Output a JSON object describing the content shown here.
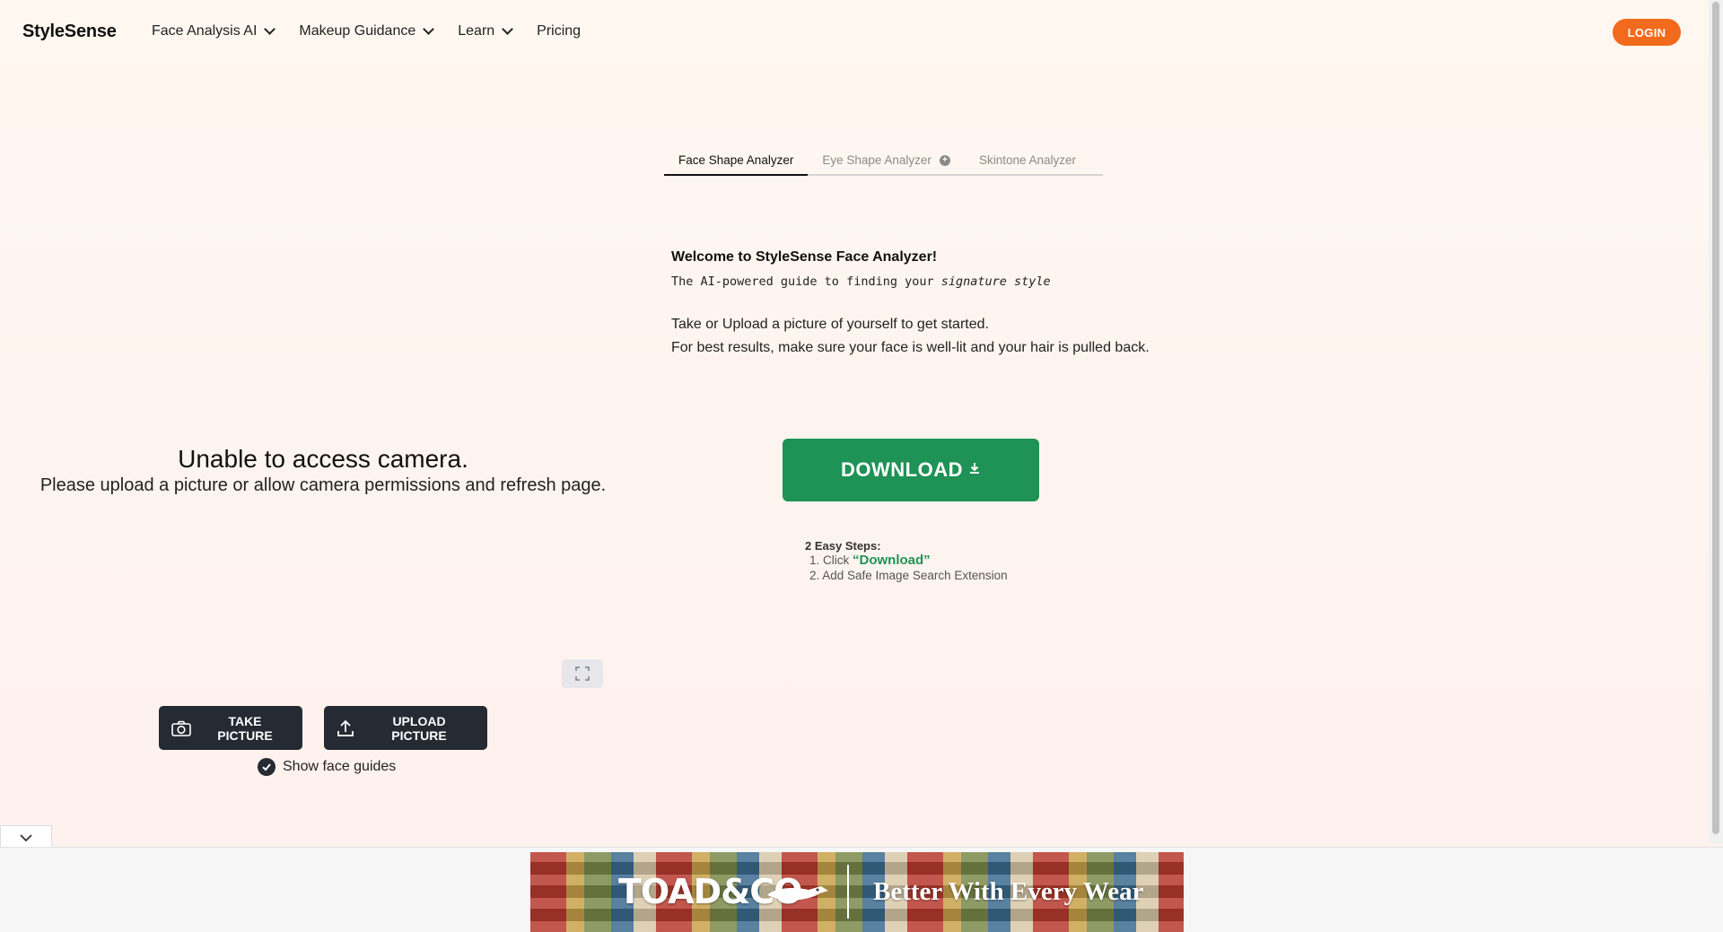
{
  "header": {
    "logo": "StyleSense",
    "nav": [
      {
        "label": "Face Analysis AI",
        "has_dropdown": true
      },
      {
        "label": "Makeup Guidance",
        "has_dropdown": true
      },
      {
        "label": "Learn",
        "has_dropdown": true
      },
      {
        "label": "Pricing",
        "has_dropdown": false
      }
    ],
    "login_label": "LOGIN"
  },
  "tabs": [
    {
      "label": "Face Shape Analyzer",
      "active": true
    },
    {
      "label": "Eye Shape Analyzer",
      "active": false,
      "icon": "plus-circle-icon"
    },
    {
      "label": "Skintone Analyzer",
      "active": false
    }
  ],
  "welcome": {
    "title": "Welcome to StyleSense Face Analyzer!",
    "tagline_prefix": "The AI-powered guide to finding your ",
    "tagline_emphasis": "signature style",
    "instruction_1": "Take or Upload a picture of yourself to get started.",
    "instruction_2": "For best results, make sure your face is well-lit and your hair is pulled back."
  },
  "camera": {
    "error_title": "Unable to access camera.",
    "error_sub": "Please upload a picture or allow camera permissions and refresh page.",
    "take_label": "TAKE PICTURE",
    "upload_label": "UPLOAD PICTURE",
    "guides_label": "Show face guides",
    "guides_checked": true
  },
  "download": {
    "label": "DOWNLOAD",
    "steps_title": "2 Easy Steps:",
    "step1_prefix": "1. Click ",
    "step1_highlight": "“Download”",
    "step2": "2. Add Safe Image Search Extension"
  },
  "ad": {
    "brand": "TOAD&CO",
    "tagline": "Better With Every Wear"
  },
  "colors": {
    "accent_orange": "#f26a1b",
    "download_green": "#1f9256",
    "dark_button": "#252a33"
  }
}
